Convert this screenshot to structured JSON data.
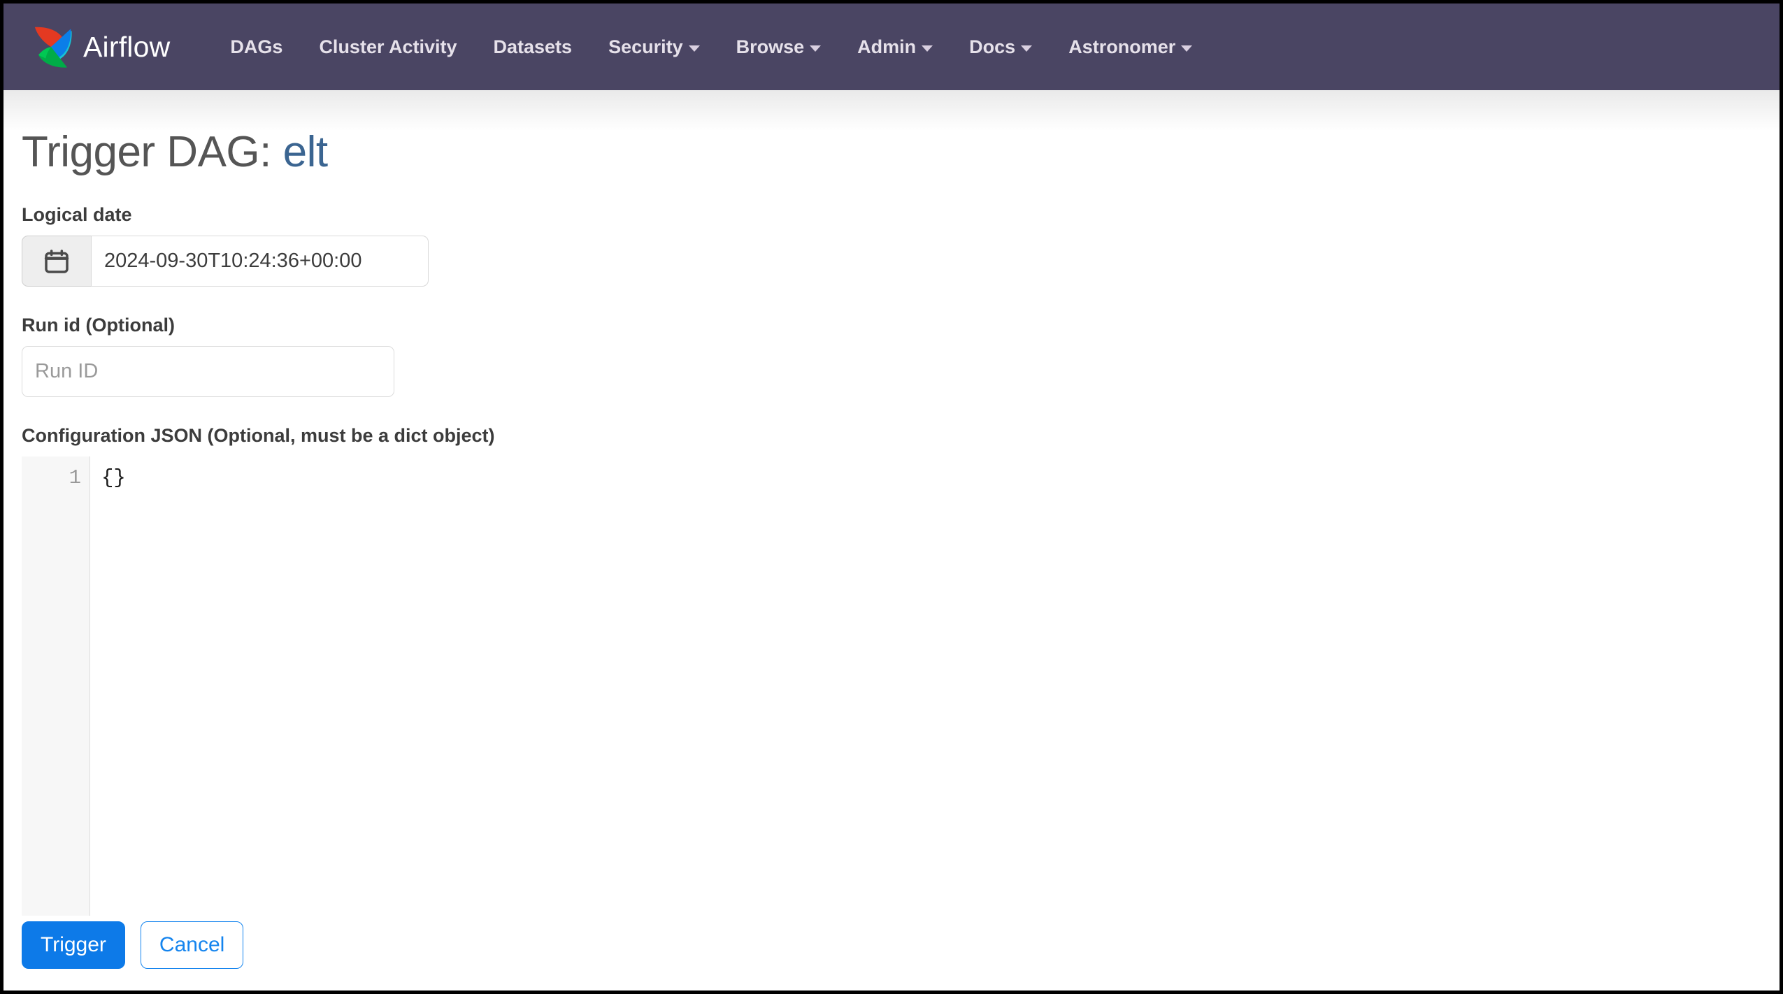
{
  "navbar": {
    "brand": {
      "label": "Airflow",
      "logo_icon": "airflow-pinwheel-icon"
    },
    "background_color": "#4a4563",
    "items": [
      {
        "label": "DAGs",
        "has_caret": false,
        "icon": ""
      },
      {
        "label": "Cluster Activity",
        "has_caret": false,
        "icon": ""
      },
      {
        "label": "Datasets",
        "has_caret": false,
        "icon": ""
      },
      {
        "label": "Security",
        "has_caret": true,
        "icon": "chevron-down-icon"
      },
      {
        "label": "Browse",
        "has_caret": true,
        "icon": "chevron-down-icon"
      },
      {
        "label": "Admin",
        "has_caret": true,
        "icon": "chevron-down-icon"
      },
      {
        "label": "Docs",
        "has_caret": true,
        "icon": "chevron-down-icon"
      },
      {
        "label": "Astronomer",
        "has_caret": true,
        "icon": "chevron-down-icon"
      }
    ]
  },
  "page": {
    "title_prefix": "Trigger DAG:",
    "dag_name": "elt",
    "dag_link_color": "#3b6591"
  },
  "form": {
    "logical_date": {
      "label": "Logical date",
      "calendar_icon": "calendar-icon",
      "value": "2024-09-30T10:24:36+00:00"
    },
    "run_id": {
      "label": "Run id (Optional)",
      "value": "",
      "placeholder": "Run ID"
    },
    "configuration_json": {
      "label": "Configuration JSON (Optional, must be a dict object)",
      "line_numbers": "1",
      "content": "{}"
    }
  },
  "actions": {
    "trigger_label": "Trigger",
    "cancel_label": "Cancel",
    "primary_color": "#0d7ae8",
    "outline_color": "#1484ee"
  }
}
